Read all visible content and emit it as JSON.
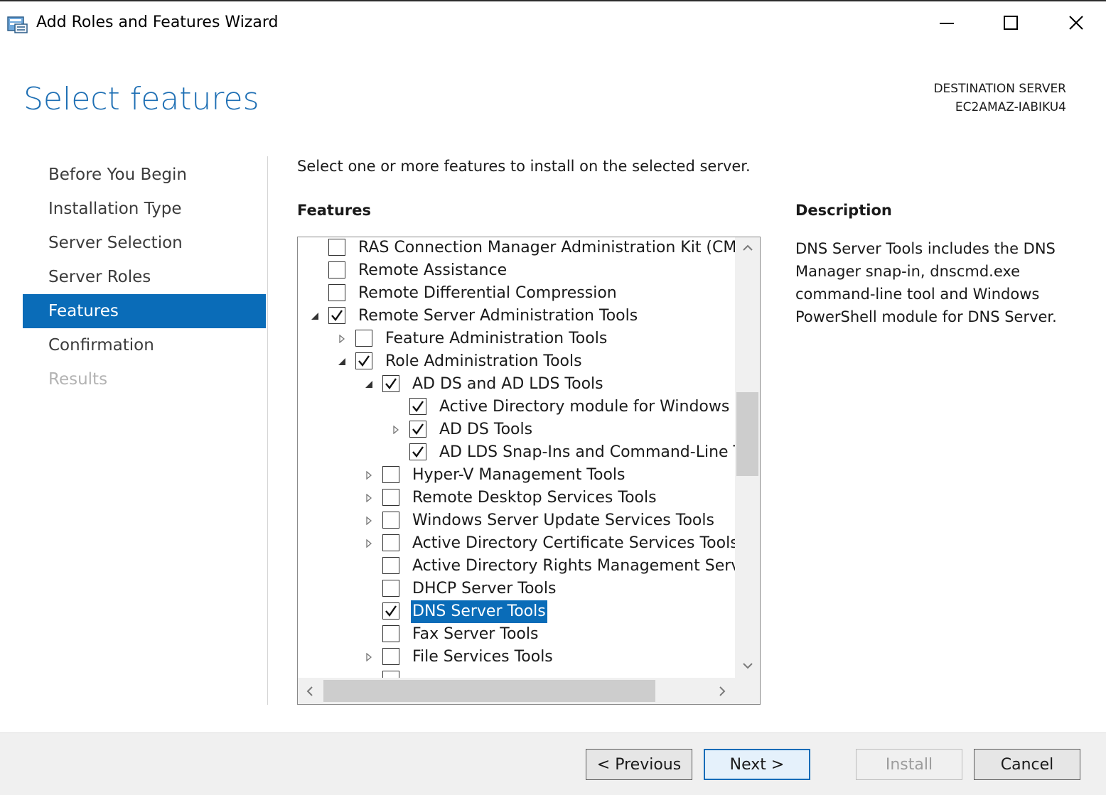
{
  "window": {
    "title": "Add Roles and Features Wizard",
    "controls": [
      "minimize-icon",
      "maximize-icon",
      "close-icon"
    ]
  },
  "header": {
    "page_title": "Select features",
    "destination_label": "DESTINATION SERVER",
    "destination_server": "EC2AMAZ-IABIKU4"
  },
  "nav": {
    "items": [
      {
        "label": "Before You Begin",
        "state": "normal"
      },
      {
        "label": "Installation Type",
        "state": "normal"
      },
      {
        "label": "Server Selection",
        "state": "normal"
      },
      {
        "label": "Server Roles",
        "state": "normal"
      },
      {
        "label": "Features",
        "state": "active"
      },
      {
        "label": "Confirmation",
        "state": "normal"
      },
      {
        "label": "Results",
        "state": "disabled"
      }
    ]
  },
  "main": {
    "instructions": "Select one or more features to install on the selected server.",
    "features_heading": "Features",
    "description_heading": "Description",
    "description_text": "DNS Server Tools includes the DNS Manager snap-in, dnscmd.exe command-line tool and Windows PowerShell module for DNS Server."
  },
  "features_tree": [
    {
      "label": "RAS Connection Manager Administration Kit (CMA",
      "level": 0,
      "checked": false,
      "expander": "none"
    },
    {
      "label": "Remote Assistance",
      "level": 0,
      "checked": false,
      "expander": "none"
    },
    {
      "label": "Remote Differential Compression",
      "level": 0,
      "checked": false,
      "expander": "none"
    },
    {
      "label": "Remote Server Administration Tools",
      "level": 0,
      "checked": true,
      "expander": "expanded"
    },
    {
      "label": "Feature Administration Tools",
      "level": 1,
      "checked": false,
      "expander": "collapsed"
    },
    {
      "label": "Role Administration Tools",
      "level": 1,
      "checked": true,
      "expander": "expanded"
    },
    {
      "label": "AD DS and AD LDS Tools",
      "level": 2,
      "checked": true,
      "expander": "expanded"
    },
    {
      "label": "Active Directory module for Windows P",
      "level": 3,
      "checked": true,
      "expander": "none"
    },
    {
      "label": "AD DS Tools",
      "level": 3,
      "checked": true,
      "expander": "collapsed"
    },
    {
      "label": "AD LDS Snap-Ins and Command-Line T",
      "level": 3,
      "checked": true,
      "expander": "none"
    },
    {
      "label": "Hyper-V Management Tools",
      "level": 2,
      "checked": false,
      "expander": "collapsed"
    },
    {
      "label": "Remote Desktop Services Tools",
      "level": 2,
      "checked": false,
      "expander": "collapsed"
    },
    {
      "label": "Windows Server Update Services Tools",
      "level": 2,
      "checked": false,
      "expander": "collapsed"
    },
    {
      "label": "Active Directory Certificate Services Tools",
      "level": 2,
      "checked": false,
      "expander": "collapsed"
    },
    {
      "label": "Active Directory Rights Management Servic",
      "level": 2,
      "checked": false,
      "expander": "none"
    },
    {
      "label": "DHCP Server Tools",
      "level": 2,
      "checked": false,
      "expander": "none"
    },
    {
      "label": "DNS Server Tools",
      "level": 2,
      "checked": true,
      "expander": "none",
      "selected": true
    },
    {
      "label": "Fax Server Tools",
      "level": 2,
      "checked": false,
      "expander": "none"
    },
    {
      "label": "File Services Tools",
      "level": 2,
      "checked": false,
      "expander": "collapsed"
    },
    {
      "label": "",
      "level": 2,
      "checked": false,
      "expander": "none"
    }
  ],
  "footer": {
    "previous_label": "< Previous",
    "next_label": "Next >",
    "install_label": "Install",
    "cancel_label": "Cancel"
  },
  "colors": {
    "accent": "#0a6cb8",
    "title_blue": "#1e6fb4",
    "footer_bg": "#f0f0f0"
  }
}
